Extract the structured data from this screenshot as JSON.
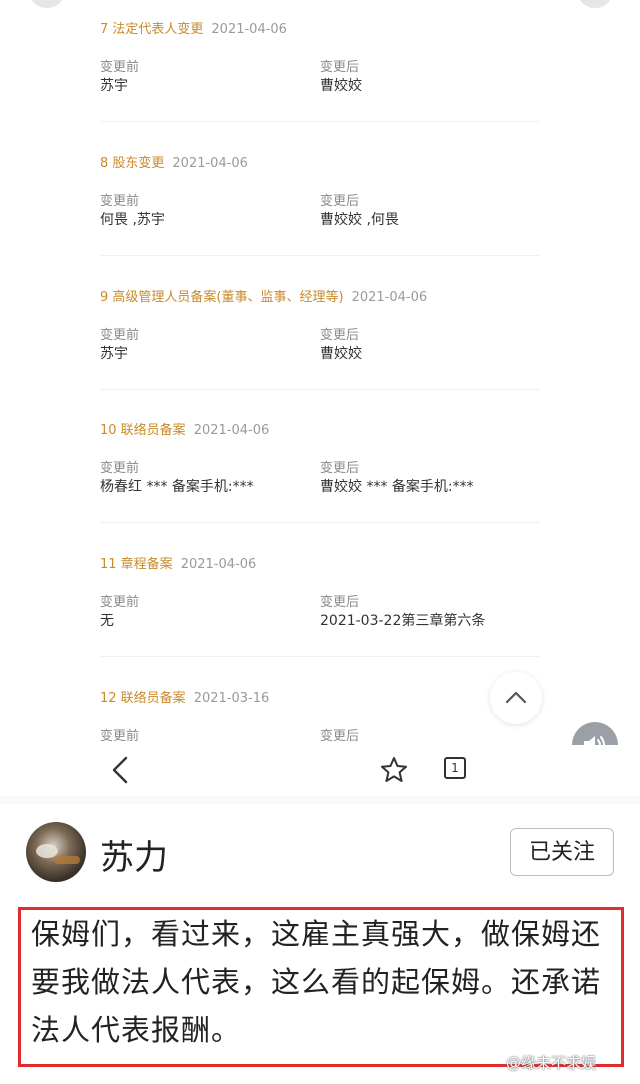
{
  "records": [
    {
      "title": "7 法定代表人变更",
      "date": "2021-04-06",
      "before_label": "变更前",
      "before_value": "苏宇",
      "after_label": "变更后",
      "after_value": "曹姣姣"
    },
    {
      "title": "8 股东变更",
      "date": "2021-04-06",
      "before_label": "变更前",
      "before_value": "何畏 ,苏宇",
      "after_label": "变更后",
      "after_value": "曹姣姣 ,何畏"
    },
    {
      "title": "9 高级管理人员备案(董事、监事、经理等)",
      "date": "2021-04-06",
      "before_label": "变更前",
      "before_value": "苏宇",
      "after_label": "变更后",
      "after_value": "曹姣姣"
    },
    {
      "title": "10 联络员备案",
      "date": "2021-04-06",
      "before_label": "变更前",
      "before_value": "杨春红 *** 备案手机:***",
      "after_label": "变更后",
      "after_value": "曹姣姣 *** 备案手机:***"
    },
    {
      "title": "11 章程备案",
      "date": "2021-04-06",
      "before_label": "变更前",
      "before_value": "无",
      "after_label": "变更后",
      "after_value": "2021-03-22第三章第六条"
    },
    {
      "title": "12 联络员备案",
      "date": "2021-03-16",
      "before_label": "变更前",
      "before_value": "",
      "after_label": "变更后",
      "after_value": ""
    }
  ],
  "nav": {
    "tab_count": "1"
  },
  "post": {
    "username": "苏力",
    "follow_label": "已关注",
    "text": "保姆们，看过来，这雇主真强大，做保姆还要我做法人代表，这么看的起保姆。还承诺法人代表报酬。"
  },
  "watermark": "@缘未不求娱",
  "colors": {
    "record_title": "#c98a2a",
    "highlight_border": "#e22b2b"
  }
}
